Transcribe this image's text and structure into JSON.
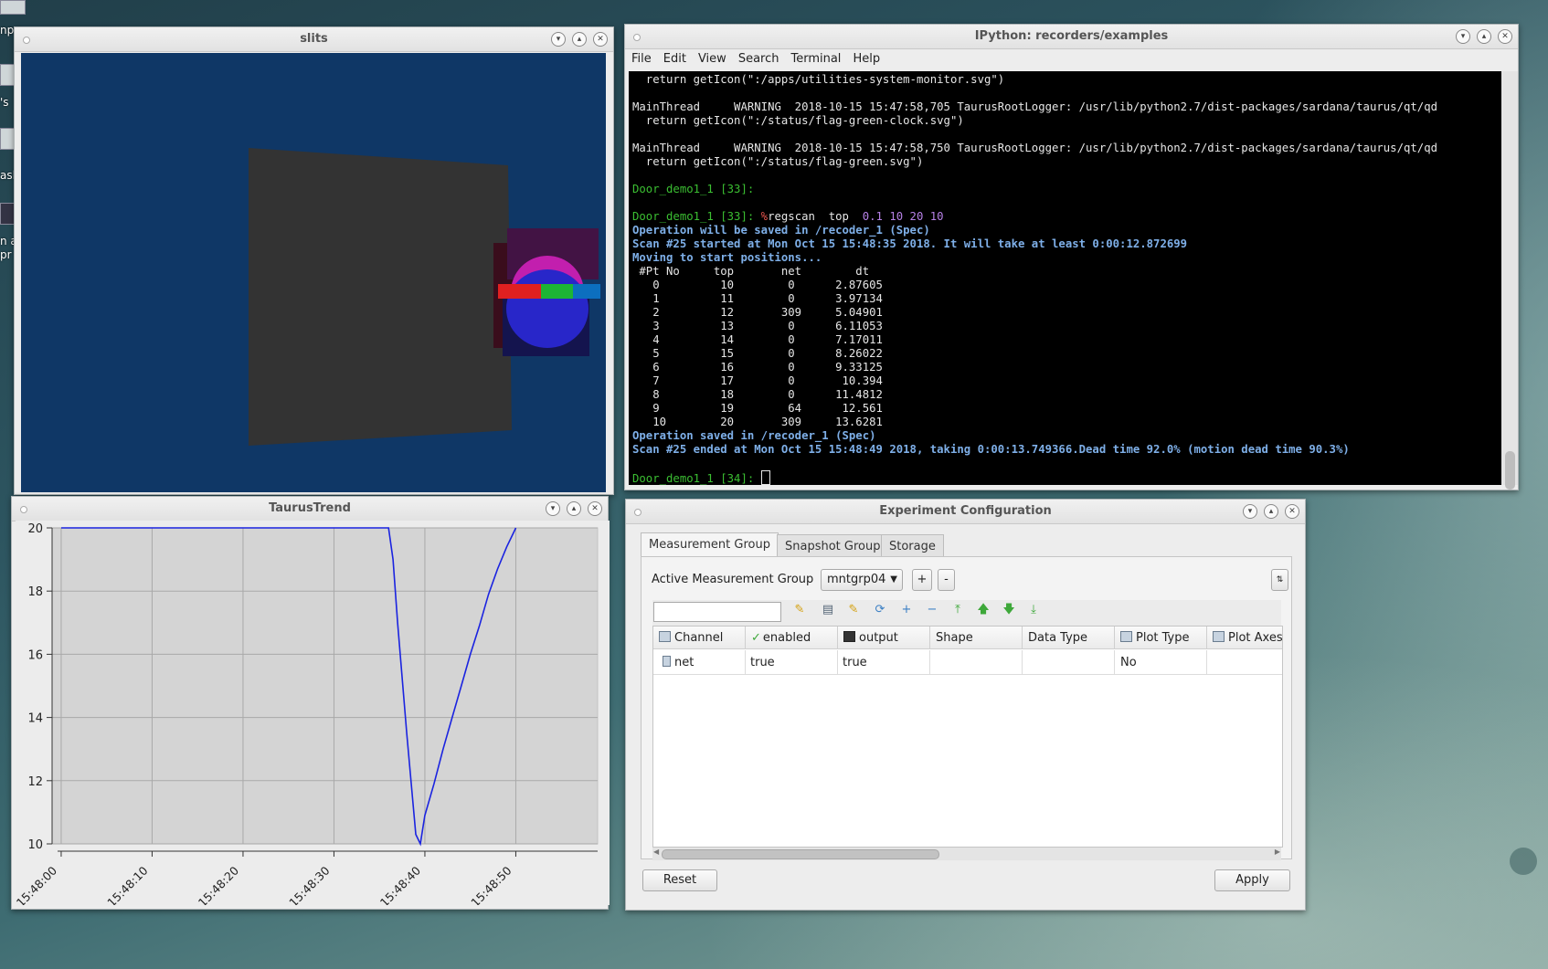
{
  "desktop": {
    "icon_labels": [
      "npu",
      "'s",
      "asl",
      "n a",
      "pr"
    ]
  },
  "slits_window": {
    "title": "slits",
    "colors": {
      "background": "#0f3766",
      "slab": "#333333",
      "sphere_top": "#c21fae",
      "sphere_bottom": "#2826c9",
      "bar_red": "#e02020",
      "bar_green": "#1db535",
      "bar_blue": "#0c6fbf"
    }
  },
  "trend_window": {
    "title": "TaurusTrend",
    "chart_data": {
      "type": "line",
      "title": "",
      "xlabel": "",
      "ylabel": "",
      "x_ticks": [
        "15:48:00",
        "15:48:10",
        "15:48:20",
        "15:48:30",
        "15:48:40",
        "15:48:50"
      ],
      "y_ticks": [
        "10",
        "12",
        "14",
        "16",
        "18",
        "20"
      ],
      "ylim": [
        10,
        20
      ],
      "xlim_seconds_after_15_48_00": [
        -1,
        59
      ],
      "grid": true,
      "series": [
        {
          "color": "#1a23e0",
          "x": [
            "15:48:00",
            "15:48:36",
            "15:48:36.5",
            "15:48:37",
            "15:48:38",
            "15:48:39",
            "15:48:39.5",
            "15:48:40",
            "15:48:41",
            "15:48:42",
            "15:48:43",
            "15:48:44",
            "15:48:45",
            "15:48:46",
            "15:48:47",
            "15:48:48",
            "15:48:49",
            "15:48:50"
          ],
          "values": [
            20,
            20,
            19.0,
            17.0,
            13.5,
            10.3,
            10.0,
            10.9,
            11.9,
            13.0,
            14.0,
            15.0,
            16.0,
            16.9,
            17.9,
            18.7,
            19.4,
            20.0
          ]
        }
      ]
    }
  },
  "terminal_window": {
    "title": "IPython: recorders/examples",
    "menu": [
      "File",
      "Edit",
      "View",
      "Search",
      "Terminal",
      "Help"
    ],
    "lines": {
      "l1": "  return getIcon(\":/apps/utilities-system-monitor.svg\")",
      "l2": "MainThread     WARNING  2018-10-15 15:47:58,705 TaurusRootLogger: /usr/lib/python2.7/dist-packages/sardana/taurus/qt/qd",
      "l3": "  return getIcon(\":/status/flag-green-clock.svg\")",
      "l4": "MainThread     WARNING  2018-10-15 15:47:58,750 TaurusRootLogger: /usr/lib/python2.7/dist-packages/sardana/taurus/qt/qd",
      "l5": "  return getIcon(\":/status/flag-green.svg\")",
      "prompt33a": "Door_demo1_1 [33]:",
      "prompt33b": "Door_demo1_1 [33]: ",
      "magic_pct": "%",
      "cmd": "regscan  top  ",
      "cmd_args": "0.1 10 20 10",
      "op_saved_in": "Operation will be saved in /recoder_1 (Spec)",
      "scan_started": "Scan #25 started at Mon Oct 15 15:48:35 2018. It will take at least 0:00:12.872699",
      "moving": "Moving to start positions...",
      "op_saved": "Operation saved in /recoder_1 (Spec)",
      "scan_ended": "Scan #25 ended at Mon Oct 15 15:48:49 2018, taking 0:00:13.749366.Dead time 92.0% (motion dead time 90.3%)",
      "prompt34": "Door_demo1_1 [34]: "
    },
    "scan_table": {
      "header": " #Pt No     top       net        dt",
      "rows": [
        "   0         10        0      2.87605",
        "   1         11        0      3.97134",
        "   2         12       309     5.04901",
        "   3         13        0      6.11053",
        "   4         14        0      7.17011",
        "   5         15        0      8.26022",
        "   6         16        0      9.33125",
        "   7         17        0       10.394",
        "   8         18        0      11.4812",
        "   9         19        64      12.561",
        "   10        20       309     13.6281"
      ]
    }
  },
  "experiment_window": {
    "title": "Experiment Configuration",
    "tabs": [
      "Measurement Group",
      "Snapshot Group",
      "Storage"
    ],
    "active_group_label": "Active Measurement Group",
    "active_group_value": "mntgrp04",
    "add_label": "+",
    "remove_label": "-",
    "filter_placeholder": "",
    "columns": [
      "Channel",
      "enabled",
      "output",
      "Shape",
      "Data Type",
      "Plot Type",
      "Plot Axes"
    ],
    "rows": [
      {
        "channel": "net",
        "enabled": "true",
        "output": "true",
        "shape": "",
        "data_type": "",
        "plot_type": "No",
        "plot_axes": ""
      }
    ],
    "reset_label": "Reset",
    "apply_label": "Apply"
  }
}
